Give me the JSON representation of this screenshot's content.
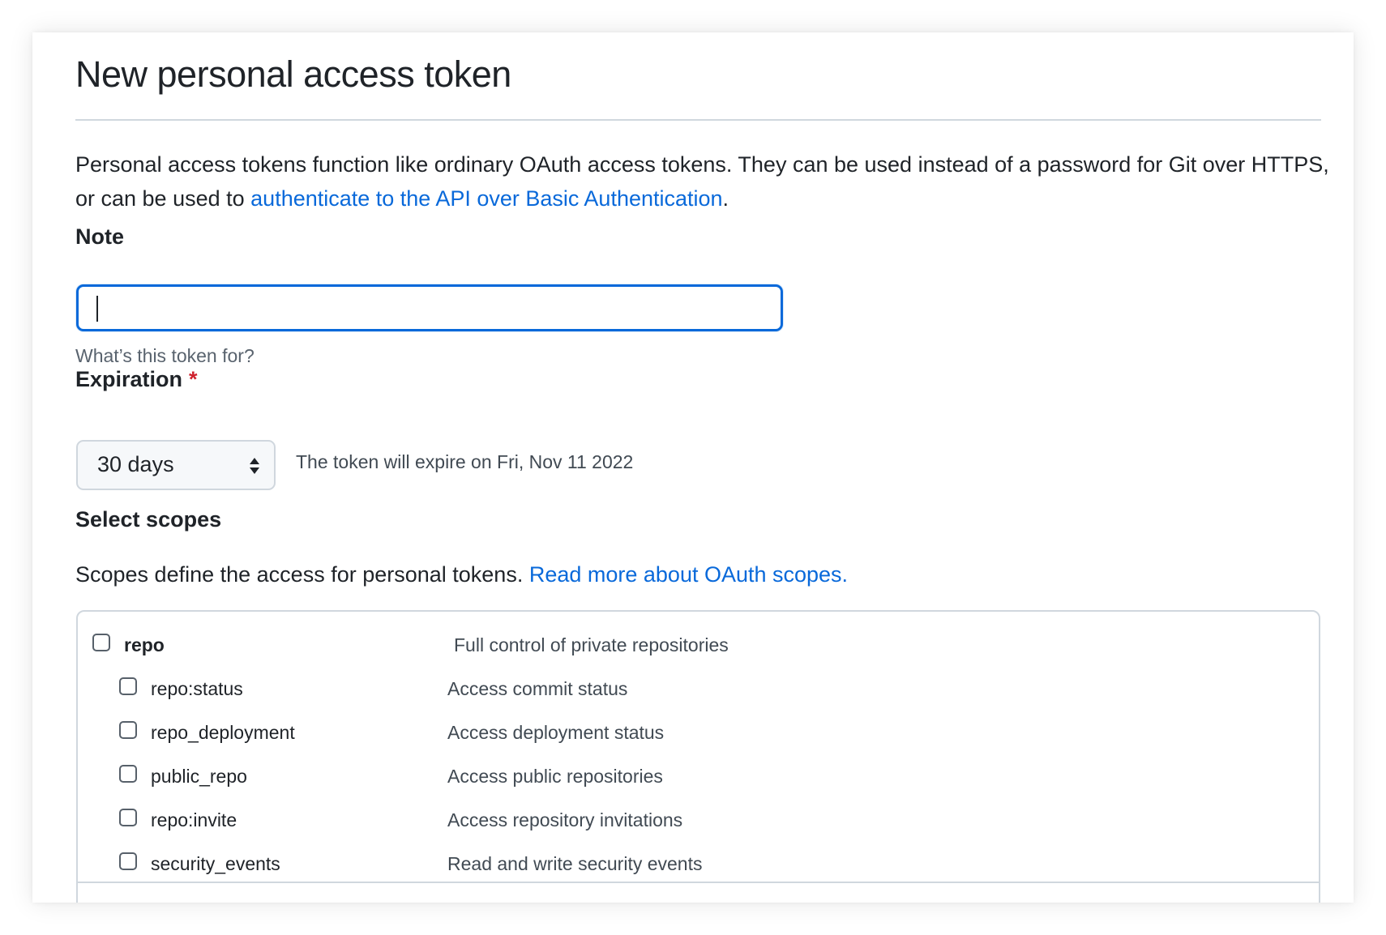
{
  "page": {
    "title": "New personal access token"
  },
  "intro": {
    "text_before": "Personal access tokens function like ordinary OAuth access tokens. They can be used instead of a password for Git over HTTPS, or can be used to ",
    "link_text": "authenticate to the API over Basic Authentication",
    "text_after": "."
  },
  "note": {
    "label": "Note",
    "value": "",
    "placeholder": "",
    "hint": "What’s this token for?"
  },
  "expiration": {
    "label": "Expiration",
    "required_marker": "*",
    "selected": "30 days",
    "expire_text": "The token will expire on Fri, Nov 11 2022"
  },
  "scopes": {
    "heading": "Select scopes",
    "desc_text": "Scopes define the access for personal tokens. ",
    "desc_link": "Read more about OAuth scopes.",
    "items": [
      {
        "name": "repo",
        "desc": "Full control of private repositories",
        "checked": false
      },
      {
        "name": "repo:status",
        "desc": "Access commit status",
        "checked": false
      },
      {
        "name": "repo_deployment",
        "desc": "Access deployment status",
        "checked": false
      },
      {
        "name": "public_repo",
        "desc": "Access public repositories",
        "checked": false
      },
      {
        "name": "repo:invite",
        "desc": "Access repository invitations",
        "checked": false
      },
      {
        "name": "security_events",
        "desc": "Read and write security events",
        "checked": false
      }
    ]
  },
  "colors": {
    "link": "#0969da",
    "focus_border": "#0969da",
    "required": "#cf222e",
    "text": "#1f2328",
    "muted": "#59636e",
    "border": "#d0d7de"
  }
}
